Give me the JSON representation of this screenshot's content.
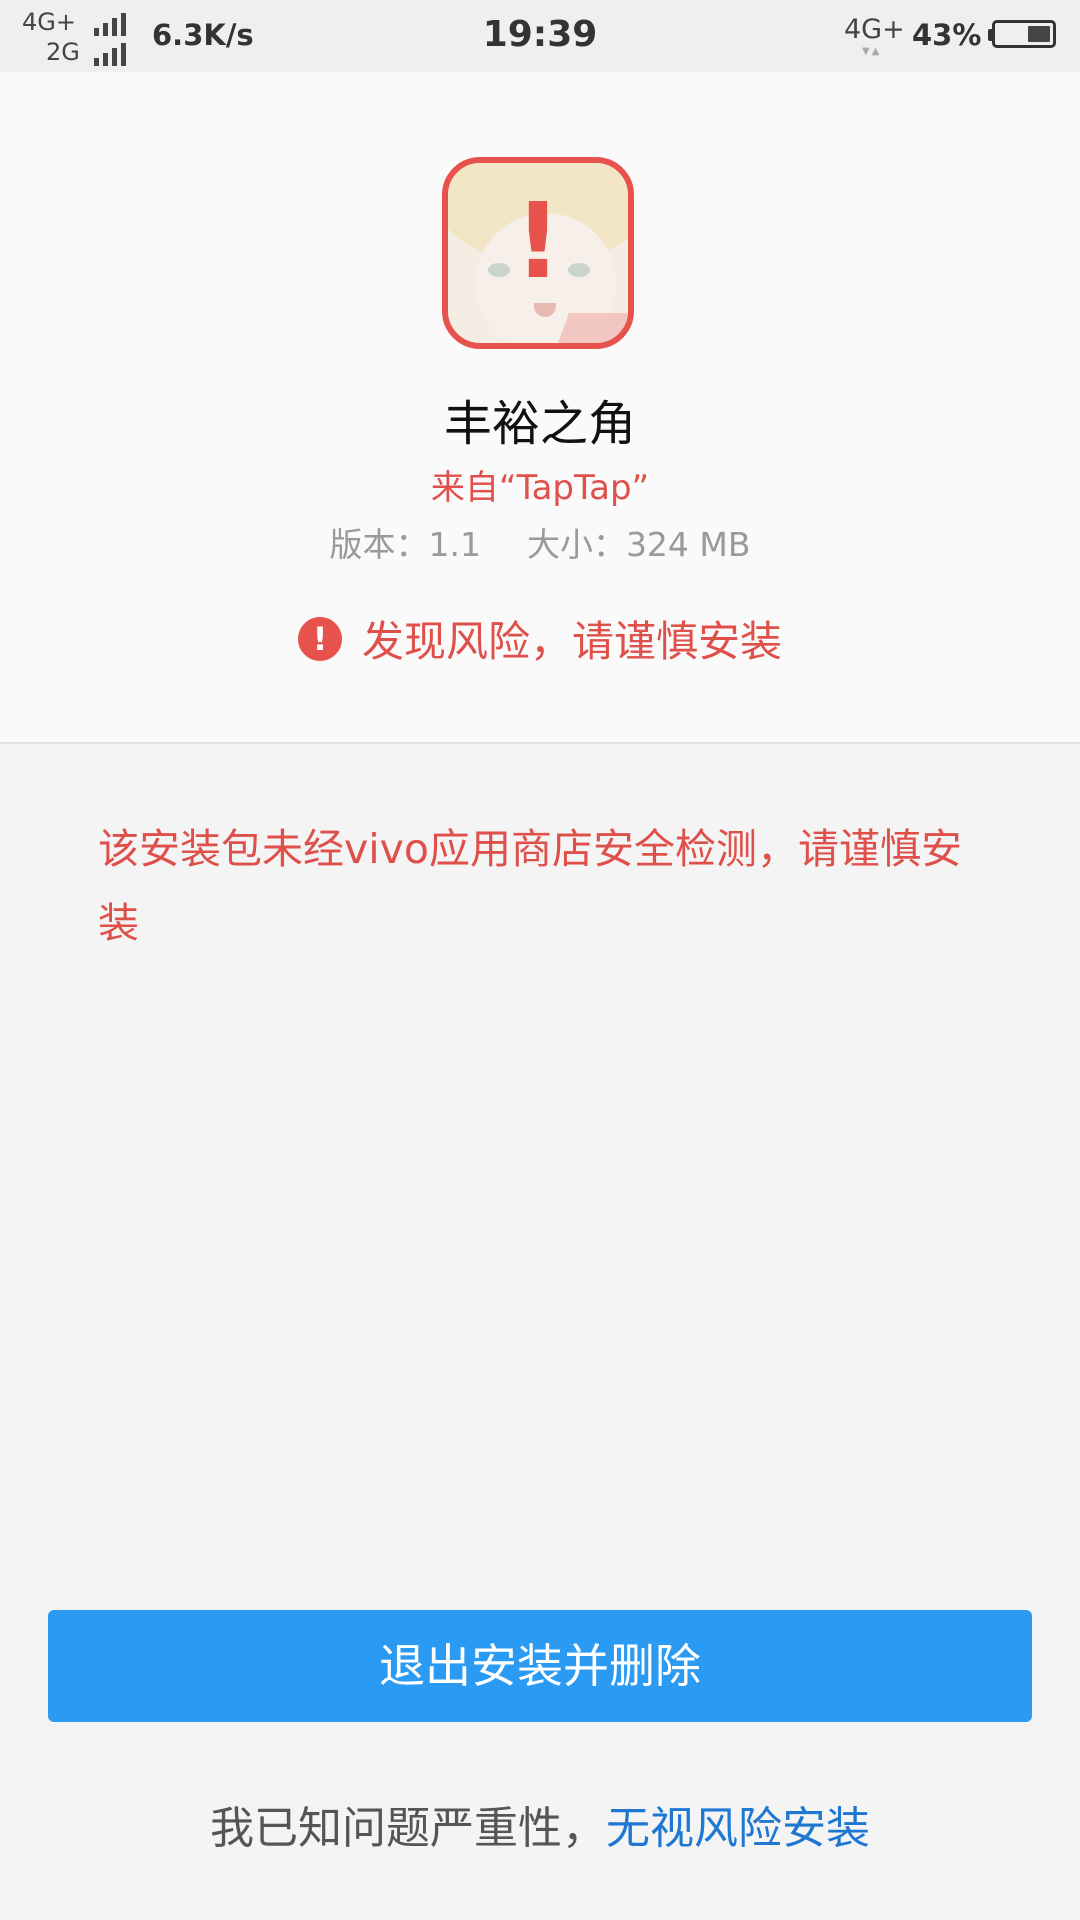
{
  "status_bar": {
    "sim1_network": "4G+",
    "sim2_network": "2G",
    "net_speed": "6.3K/s",
    "time": "19:39",
    "data_network": "4G+",
    "battery_percent": "43%",
    "battery_level": 0.43
  },
  "app": {
    "name": "丰裕之角",
    "source": "来自“TapTap”",
    "version": "版本：1.1",
    "size": "大小：324 MB",
    "icon_badge": "!"
  },
  "risk": {
    "icon": "!",
    "title": "发现风险，请谨慎安装",
    "description": "该安装包未经vivo应用商店安全检测，请谨慎安装"
  },
  "actions": {
    "exit_delete": "退出安装并删除",
    "acknowledge": "我已知问题严重性，",
    "ignore_install": "无视风险安装"
  },
  "colors": {
    "warning_red": "#e0504a",
    "primary_blue": "#2b9af2",
    "link_blue": "#1e78d2"
  }
}
